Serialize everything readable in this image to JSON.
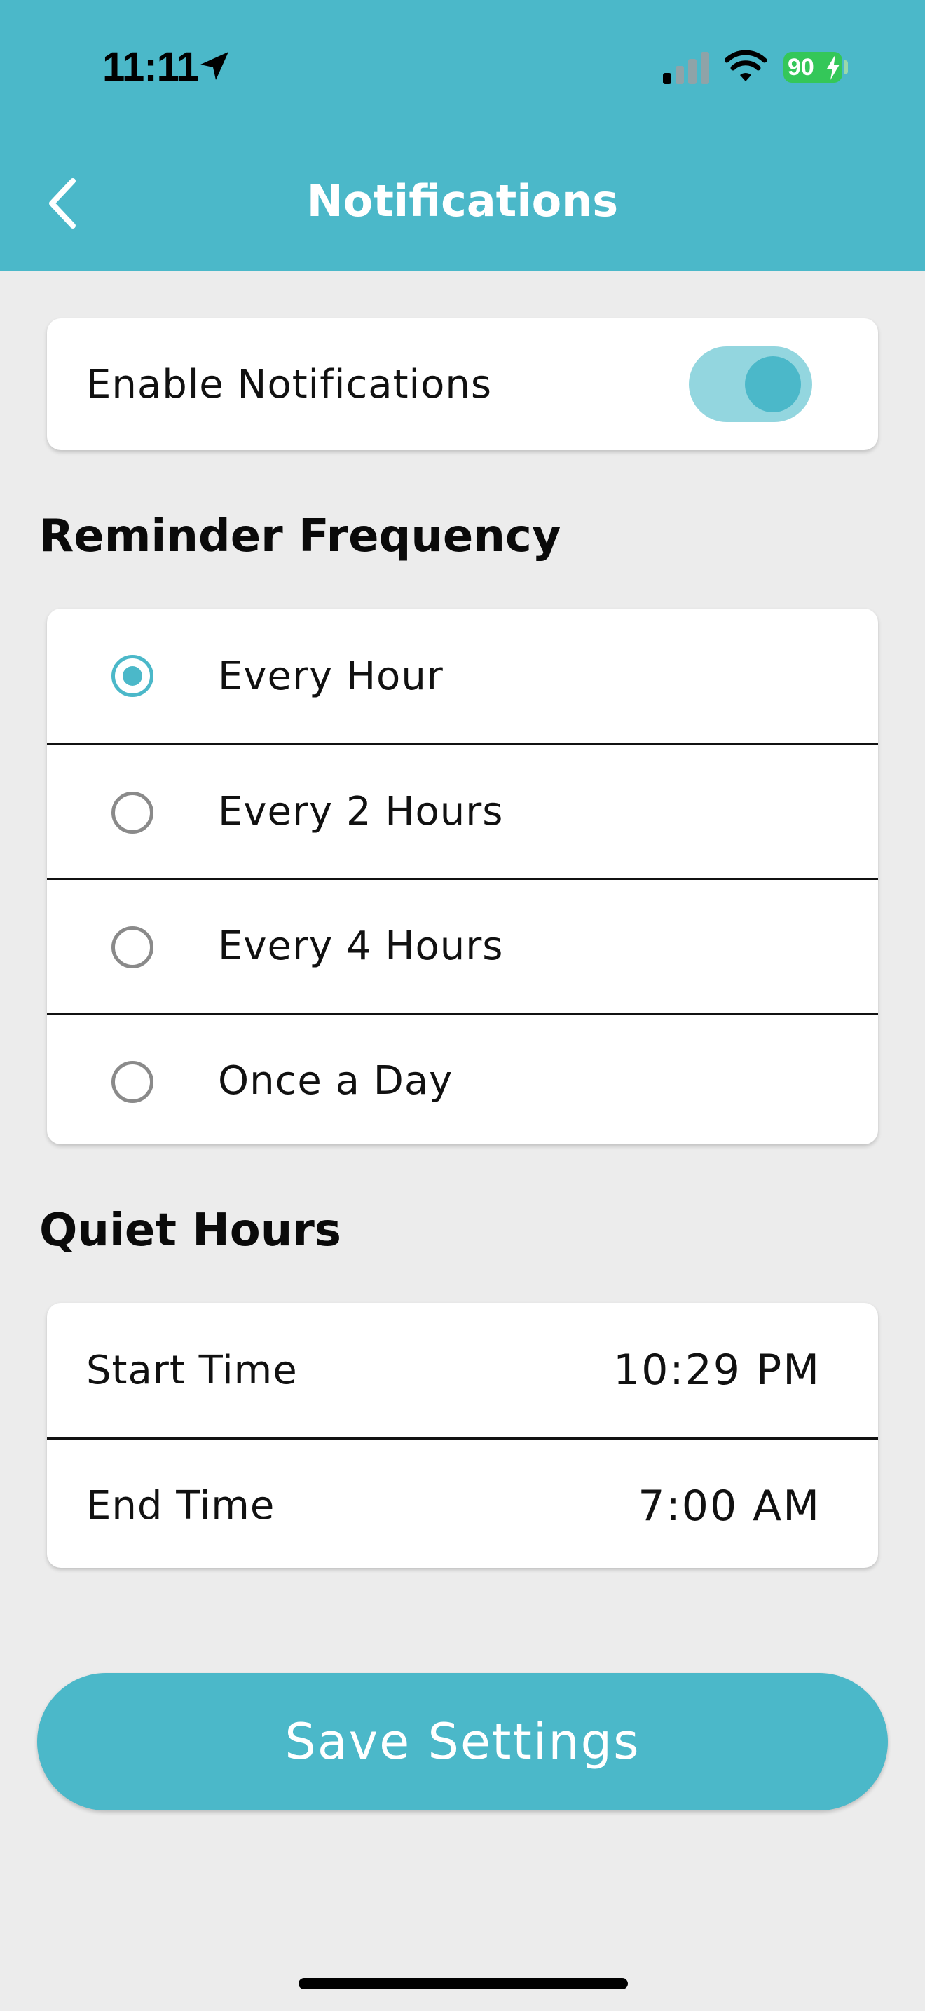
{
  "status_bar": {
    "time": "11:11",
    "battery": "90"
  },
  "header": {
    "title": "Notifications",
    "back_icon": "chevron-left-icon"
  },
  "enable_notifications": {
    "label": "Enable Notifications",
    "enabled": true
  },
  "reminder_frequency": {
    "title": "Reminder Frequency",
    "options": [
      {
        "label": "Every Hour",
        "selected": true
      },
      {
        "label": "Every 2 Hours",
        "selected": false
      },
      {
        "label": "Every 4 Hours",
        "selected": false
      },
      {
        "label": "Once a Day",
        "selected": false
      }
    ]
  },
  "quiet_hours": {
    "title": "Quiet Hours",
    "start_label": "Start Time",
    "start_value": "10:29 PM",
    "end_label": "End Time",
    "end_value": "7:00 AM"
  },
  "save_button": {
    "label": "Save Settings"
  },
  "colors": {
    "accent": "#4bb8c9",
    "toggle_track": "#93d6df",
    "background": "#ececec"
  }
}
